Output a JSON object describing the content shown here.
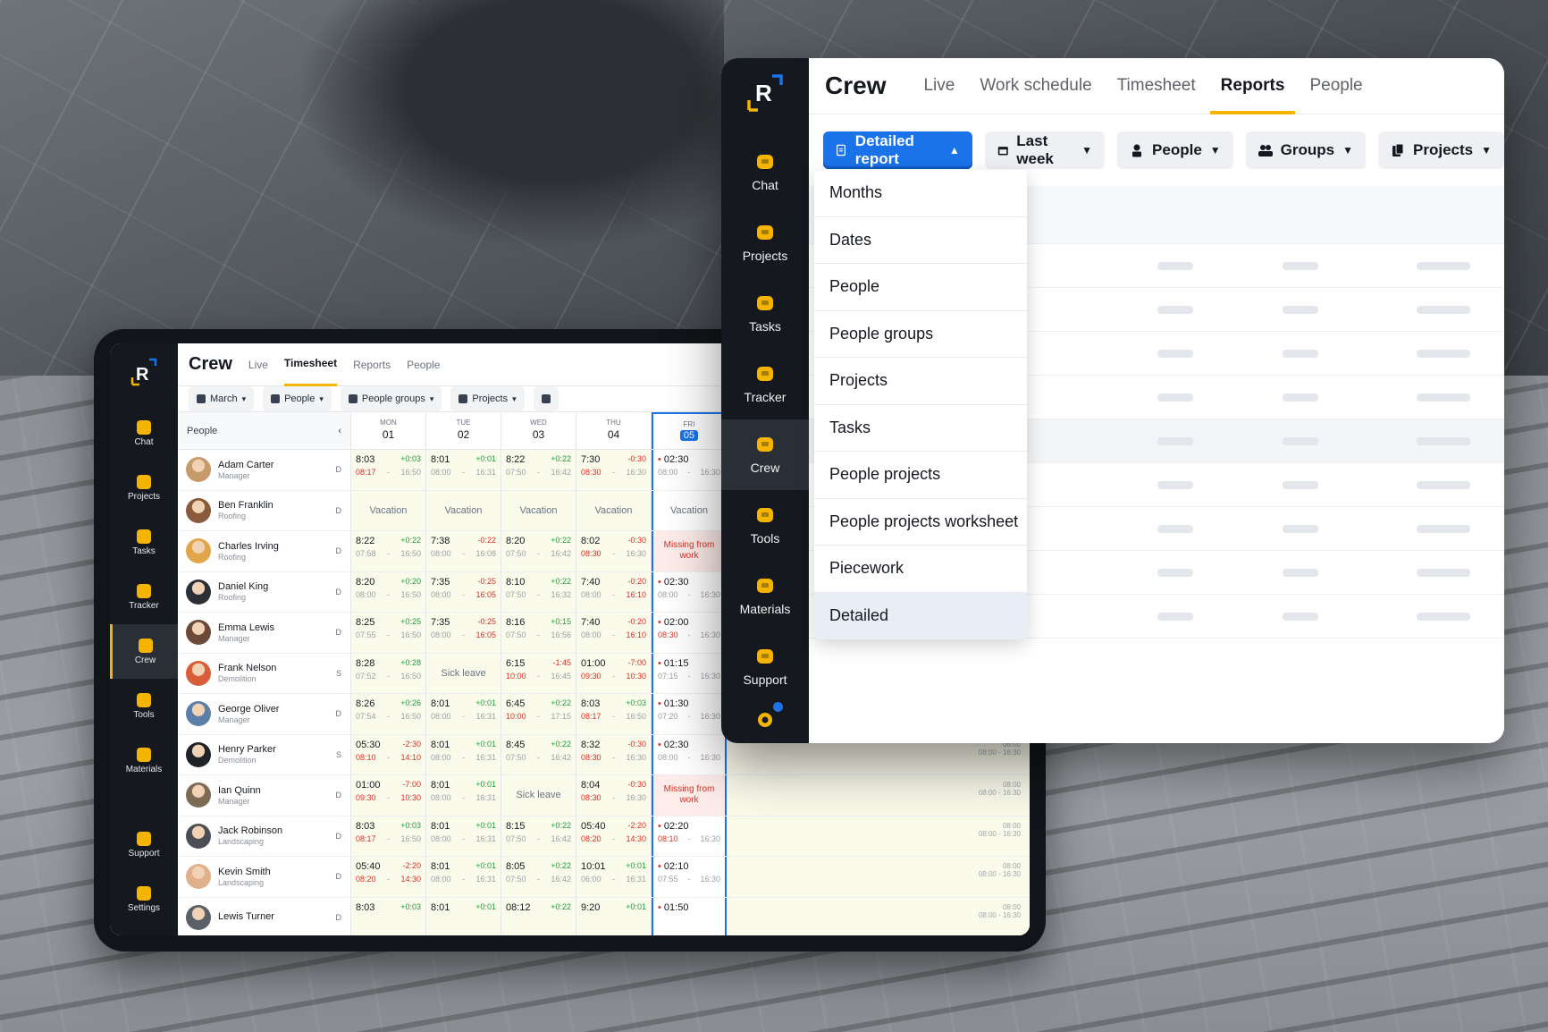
{
  "front": {
    "brand": "Crew",
    "tabs": [
      {
        "label": "Live"
      },
      {
        "label": "Work schedule"
      },
      {
        "label": "Timesheet"
      },
      {
        "label": "Reports",
        "active": true
      },
      {
        "label": "People"
      }
    ],
    "sidebar": [
      {
        "label": "Chat",
        "icon": "chat-icon"
      },
      {
        "label": "Projects",
        "icon": "projects-icon"
      },
      {
        "label": "Tasks",
        "icon": "tasks-icon"
      },
      {
        "label": "Tracker",
        "icon": "tracker-icon"
      },
      {
        "label": "Crew",
        "icon": "crew-icon",
        "active": true
      },
      {
        "label": "Tools",
        "icon": "tools-icon"
      },
      {
        "label": "Materials",
        "icon": "materials-icon"
      },
      {
        "label": "Support",
        "icon": "support-icon"
      }
    ],
    "filters": {
      "report": "Detailed report",
      "period": "Last week",
      "people": "People",
      "groups": "Groups",
      "projects": "Projects"
    },
    "report_menu": [
      "Months",
      "Dates",
      "People",
      "People groups",
      "Projects",
      "Tasks",
      "People projects",
      "People projects worksheet",
      "Piecework",
      "Detailed"
    ],
    "report_menu_selected": "Detailed",
    "colors": {
      "accent": "#f4b400",
      "primary": "#1a73e8",
      "sidebar": "#15191f"
    }
  },
  "tablet": {
    "brand": "Crew",
    "tabs": [
      {
        "label": "Live"
      },
      {
        "label": "Timesheet",
        "active": true
      },
      {
        "label": "Reports"
      },
      {
        "label": "People"
      }
    ],
    "sidebar": [
      {
        "label": "Chat"
      },
      {
        "label": "Projects"
      },
      {
        "label": "Tasks"
      },
      {
        "label": "Tracker"
      },
      {
        "label": "Crew",
        "active": true
      },
      {
        "label": "Tools"
      },
      {
        "label": "Materials"
      }
    ],
    "sidebar_bottom": [
      {
        "label": "Support"
      },
      {
        "label": "Settings"
      }
    ],
    "filters": {
      "month": "March",
      "people": "People",
      "groups": "People groups",
      "projects": "Projects"
    },
    "people_header": "People",
    "days": [
      {
        "dow": "MON",
        "num": "01"
      },
      {
        "dow": "TUE",
        "num": "02"
      },
      {
        "dow": "WED",
        "num": "03"
      },
      {
        "dow": "THU",
        "num": "04"
      },
      {
        "dow": "FRI",
        "num": "05",
        "today": true
      }
    ],
    "ghost_times": {
      "start": "08:00",
      "range_a": "08:00",
      "range_b": "16:30"
    },
    "rows": [
      {
        "name": "Adam Carter",
        "role": "Manager",
        "code": "D",
        "avatar": "#c79a6b",
        "cells": [
          {
            "t": "8:03",
            "d": "+0:03",
            "a": "08:17",
            "b": "16:50",
            "ar": true
          },
          {
            "t": "8:01",
            "d": "+0:01",
            "a": "08:00",
            "b": "16:31"
          },
          {
            "t": "8:22",
            "d": "+0:22",
            "a": "07:50",
            "b": "16:42"
          },
          {
            "t": "7:30",
            "d": "-0:30",
            "a": "08:30",
            "b": "16:30",
            "ar": true
          },
          {
            "t": "02:30",
            "a": "08:00",
            "b": "16:30",
            "bullet": true
          }
        ]
      },
      {
        "name": "Ben Franklin",
        "role": "Roofing",
        "code": "D",
        "avatar": "#8a5a3c",
        "cells": [
          {
            "label": "Vacation"
          },
          {
            "label": "Vacation"
          },
          {
            "label": "Vacation"
          },
          {
            "label": "Vacation"
          },
          {
            "label": "Vacation"
          }
        ]
      },
      {
        "name": "Charles Irving",
        "role": "Roofing",
        "code": "D",
        "avatar": "#e2a64a",
        "cells": [
          {
            "t": "8:22",
            "d": "+0:22",
            "a": "07:58",
            "b": "16:50"
          },
          {
            "t": "7:38",
            "d": "-0:22",
            "a": "08:00",
            "b": "16:08"
          },
          {
            "t": "8:20",
            "d": "+0:22",
            "a": "07:50",
            "b": "16:42"
          },
          {
            "t": "8:02",
            "d": "-0:30",
            "a": "08:30",
            "b": "16:30",
            "ar": true
          },
          {
            "missing": "Missing from work"
          }
        ]
      },
      {
        "name": "Daniel King",
        "role": "Roofing",
        "code": "D",
        "avatar": "#2d2f36",
        "cells": [
          {
            "t": "8:20",
            "d": "+0:20",
            "a": "08:00",
            "b": "16:50"
          },
          {
            "t": "7:35",
            "d": "-0:25",
            "a": "08:00",
            "b": "16:05",
            "br": true
          },
          {
            "t": "8:10",
            "d": "+0:22",
            "a": "07:50",
            "b": "16:32"
          },
          {
            "t": "7:40",
            "d": "-0:20",
            "a": "08:00",
            "b": "16:10",
            "br": true
          },
          {
            "t": "02:30",
            "a": "08:00",
            "b": "16:30",
            "bullet": true
          }
        ]
      },
      {
        "name": "Emma Lewis",
        "role": "Manager",
        "code": "D",
        "avatar": "#6b4a3a",
        "cells": [
          {
            "t": "8:25",
            "d": "+0:25",
            "a": "07:55",
            "b": "16:50"
          },
          {
            "t": "7:35",
            "d": "-0:25",
            "a": "08:00",
            "b": "16:05",
            "br": true
          },
          {
            "t": "8:16",
            "d": "+0:15",
            "a": "07:50",
            "b": "16:56"
          },
          {
            "t": "7:40",
            "d": "-0:20",
            "a": "08:00",
            "b": "16:10",
            "br": true
          },
          {
            "t": "02:00",
            "a": "08:30",
            "b": "16:30",
            "bullet": true,
            "ar": true
          }
        ]
      },
      {
        "name": "Frank Nelson",
        "role": "Demolition",
        "code": "S",
        "avatar": "#d95d39",
        "cells": [
          {
            "t": "8:28",
            "d": "+0:28",
            "a": "07:52",
            "b": "16:50"
          },
          {
            "label": "Sick leave"
          },
          {
            "t": "6:15",
            "d": "-1:45",
            "a": "10:00",
            "b": "16:45",
            "ar": true
          },
          {
            "t": "01:00",
            "d": "-7:00",
            "a": "09:30",
            "b": "10:30",
            "ar": true,
            "br": true
          },
          {
            "t": "01:15",
            "a": "07:15",
            "b": "16:30",
            "bullet": true
          }
        ]
      },
      {
        "name": "George Oliver",
        "role": "Manager",
        "code": "D",
        "avatar": "#5a7fa8",
        "cells": [
          {
            "t": "8:26",
            "d": "+0:26",
            "a": "07:54",
            "b": "16:50"
          },
          {
            "t": "8:01",
            "d": "+0:01",
            "a": "08:00",
            "b": "16:31"
          },
          {
            "t": "6:45",
            "d": "+0:22",
            "a": "10:00",
            "b": "17:15",
            "ar": true
          },
          {
            "t": "8:03",
            "d": "+0:03",
            "a": "08:17",
            "b": "16:50",
            "ar": true
          },
          {
            "t": "01:30",
            "a": "07:20",
            "b": "16:30",
            "bullet": true
          }
        ]
      },
      {
        "name": "Henry Parker",
        "role": "Demolition",
        "code": "S",
        "avatar": "#1f2226",
        "cells": [
          {
            "t": "05:30",
            "d": "-2:30",
            "a": "08:10",
            "b": "14:10",
            "ar": true,
            "br": true
          },
          {
            "t": "8:01",
            "d": "+0:01",
            "a": "08:00",
            "b": "16:31"
          },
          {
            "t": "8:45",
            "d": "+0:22",
            "a": "07:50",
            "b": "16:42"
          },
          {
            "t": "8:32",
            "d": "-0:30",
            "a": "08:30",
            "b": "16:30",
            "ar": true
          },
          {
            "t": "02:30",
            "a": "08:00",
            "b": "16:30",
            "bullet": true
          }
        ]
      },
      {
        "name": "Ian Quinn",
        "role": "Manager",
        "code": "D",
        "avatar": "#7d6a55",
        "cells": [
          {
            "t": "01:00",
            "d": "-7:00",
            "a": "09:30",
            "b": "10:30",
            "ar": true,
            "br": true
          },
          {
            "t": "8:01",
            "d": "+0:01",
            "a": "08:00",
            "b": "16:31"
          },
          {
            "label": "Sick leave"
          },
          {
            "t": "8:04",
            "d": "-0:30",
            "a": "08:30",
            "b": "16:30",
            "ar": true
          },
          {
            "missing": "Missing from work"
          }
        ]
      },
      {
        "name": "Jack Robinson",
        "role": "Landscaping",
        "code": "D",
        "avatar": "#4b4f55",
        "cells": [
          {
            "t": "8:03",
            "d": "+0:03",
            "a": "08:17",
            "b": "16:50",
            "ar": true
          },
          {
            "t": "8:01",
            "d": "+0:01",
            "a": "08:00",
            "b": "16:31"
          },
          {
            "t": "8:15",
            "d": "+0:22",
            "a": "07:50",
            "b": "16:42"
          },
          {
            "t": "05:40",
            "d": "-2:20",
            "a": "08:20",
            "b": "14:30",
            "ar": true,
            "br": true
          },
          {
            "t": "02:20",
            "a": "08:10",
            "b": "16:30",
            "bullet": true,
            "ar": true
          }
        ]
      },
      {
        "name": "Kevin Smith",
        "role": "Landscaping",
        "code": "D",
        "avatar": "#e0b08a",
        "cells": [
          {
            "t": "05:40",
            "d": "-2:20",
            "a": "08:20",
            "b": "14:30",
            "ar": true,
            "br": true
          },
          {
            "t": "8:01",
            "d": "+0:01",
            "a": "08:00",
            "b": "16:31"
          },
          {
            "t": "8:05",
            "d": "+0:22",
            "a": "07:50",
            "b": "16:42"
          },
          {
            "t": "10:01",
            "d": "+0:01",
            "a": "06:00",
            "b": "16:31"
          },
          {
            "t": "02:10",
            "a": "07:55",
            "b": "16:30",
            "bullet": true
          }
        ]
      },
      {
        "name": "Lewis Turner",
        "role": "",
        "code": "D",
        "avatar": "#5b5f66",
        "cells": [
          {
            "t": "8:03",
            "d": "+0:03",
            "a": "",
            "b": ""
          },
          {
            "t": "8:01",
            "d": "+0:01",
            "a": "",
            "b": ""
          },
          {
            "t": "08:12",
            "d": "+0:22",
            "a": "",
            "b": ""
          },
          {
            "t": "9:20",
            "d": "+0:01",
            "a": "",
            "b": ""
          },
          {
            "t": "01:50",
            "a": "",
            "b": "",
            "bullet": true
          }
        ]
      }
    ]
  }
}
